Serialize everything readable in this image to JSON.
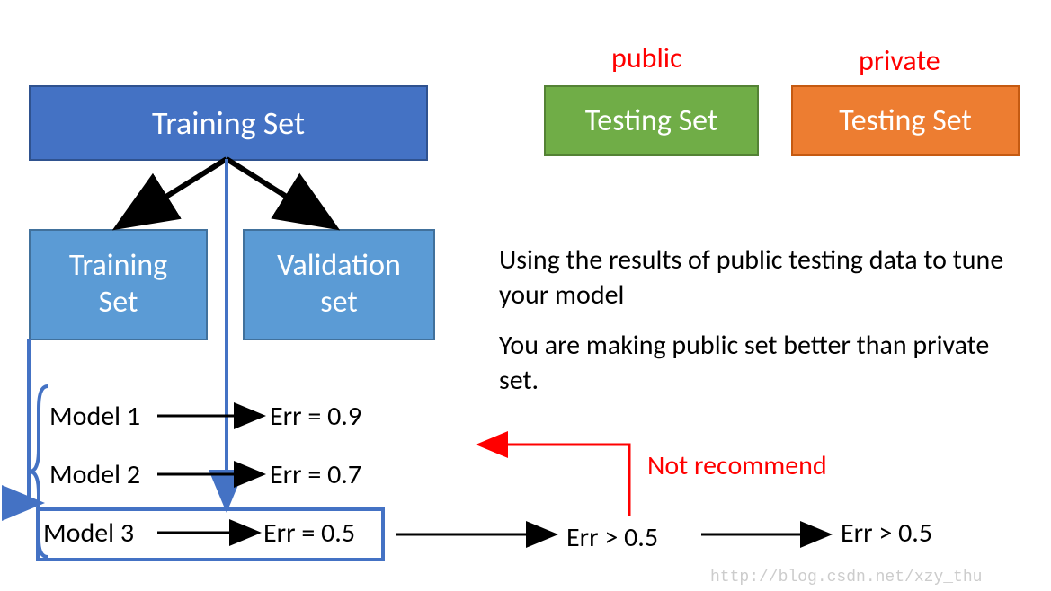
{
  "boxes": {
    "training_big": "Training Set",
    "training_small": "Training\nSet",
    "validation": "Validation\nset",
    "testing_public": "Testing Set",
    "testing_private": "Testing Set"
  },
  "labels": {
    "public": "public",
    "private": "private",
    "not_recommend": "Not recommend",
    "desc1": "Using the results of public testing data to tune your model",
    "desc2": "You are making public set better than private set."
  },
  "models": {
    "m1": "Model 1",
    "m2": "Model 2",
    "m3": "Model 3",
    "e1": "Err = 0.9",
    "e2": "Err = 0.7",
    "e3": "Err = 0.5",
    "e4": "Err > 0.5",
    "e5": "Err > 0.5"
  },
  "watermark": "http://blog.csdn.net/xzy_thu"
}
